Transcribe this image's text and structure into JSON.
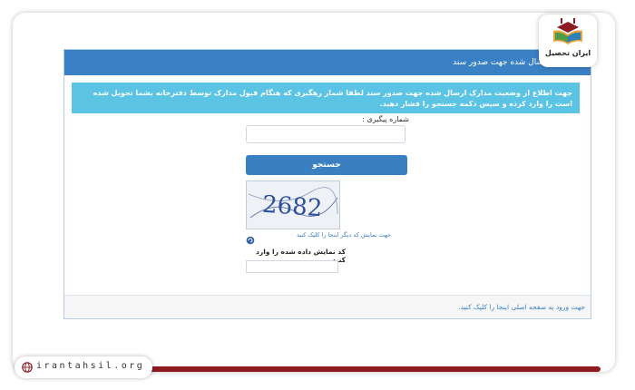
{
  "panel": {
    "header_title": "سال شده جهت صدور سند",
    "alert_text": "جهت اطلاع از وضعیت مدارک ارسال شده جهت صدور سند لطفا شمار رهگیری که هنگام قبول مدارک توسط دفترخانه بشما تحویل شده است را وارد کرده و سپس دکمه جستجو را فشار دهید.",
    "tracking_label": "شماره پیگیری :",
    "search_label": "جستجو",
    "captcha_code": "2682",
    "refresh_text": "جهت نمایش کد دیگر اینجا را کلیک کنید",
    "captcha_label": "کد نمایش داده شده را وارد کنید",
    "footer_link": "جهت ورود به صفحه اصلی اینجا را کلیک کنید."
  },
  "brand": {
    "logo_name": "ایران تحصیل",
    "site": "irantahsil.org"
  },
  "colors": {
    "header": "#3a80c4",
    "alert": "#5bc4e4",
    "button": "#3a7fc0",
    "accent_line": "#8e1b22"
  }
}
